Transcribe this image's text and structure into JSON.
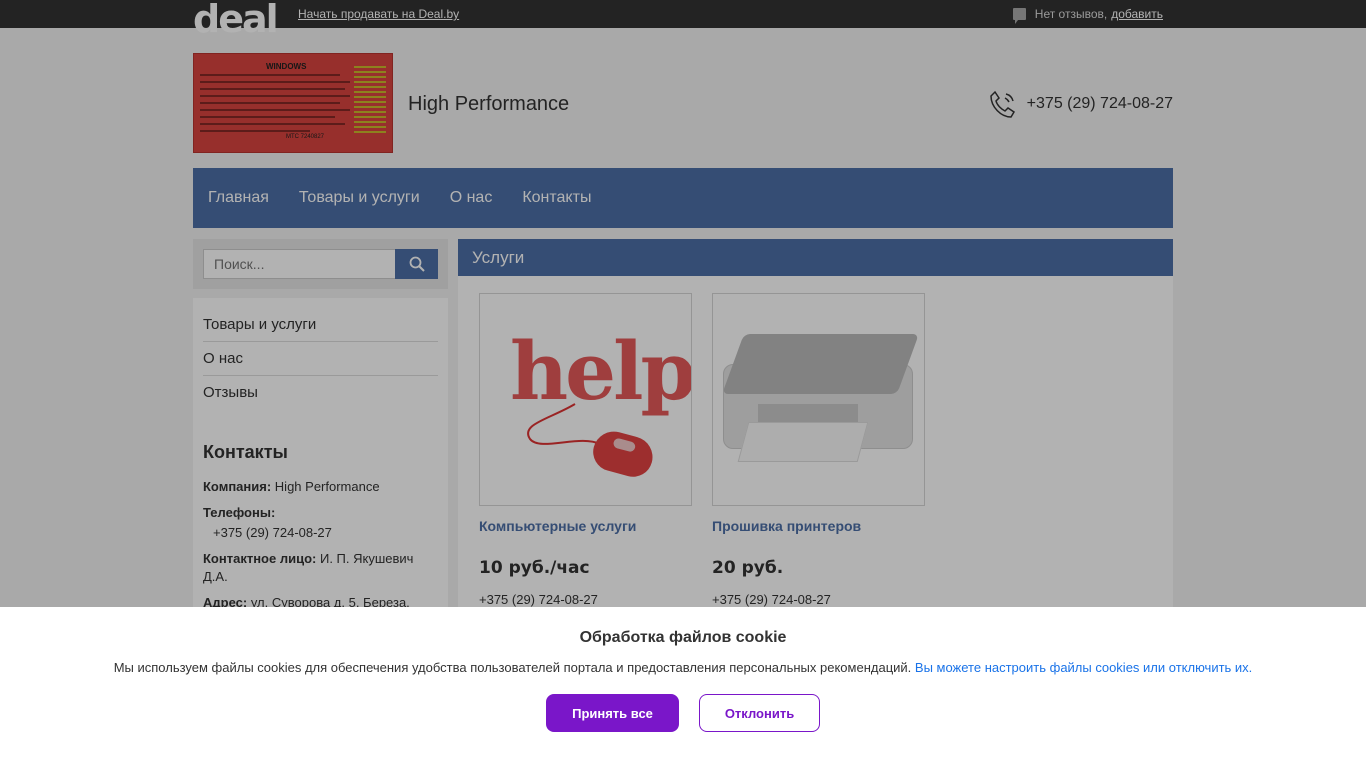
{
  "topbar": {
    "logo": "deal",
    "sell_link": "Начать продавать на Deal.by",
    "reviews_text": "Нет отзывов,",
    "reviews_add": "добавить"
  },
  "header": {
    "banner_title": "WINDOWS",
    "banner_footer": "МТС 7240827",
    "company_name": "High Performance",
    "phone": "+375 (29) 724-08-27"
  },
  "nav": {
    "items": [
      "Главная",
      "Товары и услуги",
      "О нас",
      "Контакты"
    ]
  },
  "sidebar": {
    "search_placeholder": "Поиск...",
    "menu": [
      "Товары и услуги",
      "О нас",
      "Отзывы"
    ],
    "contacts_title": "Контакты",
    "company_label": "Компания:",
    "company_value": "High Performance",
    "phones_label": "Телефоны:",
    "phones_value": "+375 (29) 724-08-27",
    "person_label": "Контактное лицо:",
    "person_value": "И. П. Якушевич Д.А.",
    "address_label": "Адрес:",
    "address_value": "ул. Суворова д. 5, Береза,"
  },
  "main": {
    "title": "Услуги",
    "cards": [
      {
        "name": "Компьютерные услуги",
        "price": "10 руб./час",
        "phone": "+375 (29) 724-08-27",
        "image": "help-mouse-image"
      },
      {
        "name": "Прошивка принтеров",
        "price": "20 руб.",
        "phone": "+375 (29) 724-08-27",
        "image": "printer-image"
      }
    ]
  },
  "cookie": {
    "title": "Обработка файлов cookie",
    "text": "Мы используем файлы cookies для обеспечения удобства пользователей портала и предоставления персональных рекомендаций.",
    "link": "Вы можете настроить файлы cookies или отключить их.",
    "accept": "Принять все",
    "decline": "Отклонить"
  },
  "colors": {
    "accent": "#4d6fa6",
    "topbar": "#333333",
    "cookie_button": "#7a16c9"
  }
}
